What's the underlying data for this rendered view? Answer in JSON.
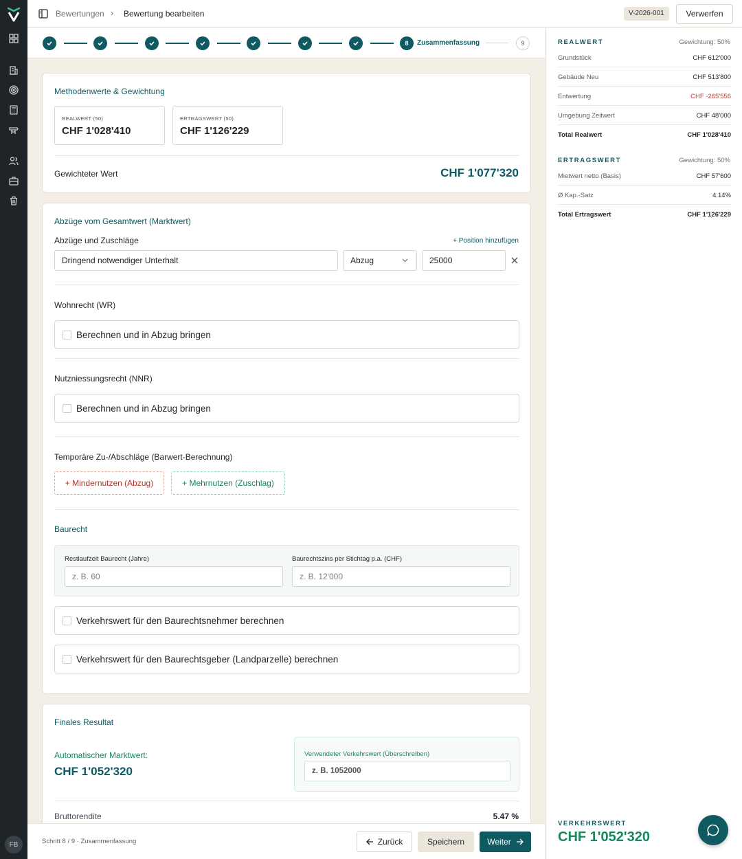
{
  "rail": {
    "avatar_initials": "FB",
    "icons": [
      "dashboard-icon",
      "building-icon",
      "target-icon",
      "calculator-icon",
      "signpost-icon",
      "users-icon",
      "briefcase-icon",
      "trash-icon"
    ]
  },
  "header": {
    "breadcrumb_parent": "Bewertungen",
    "breadcrumb_separator": "›",
    "breadcrumb_current": "Bewertung bearbeiten",
    "valuation_id": "V-2026-001",
    "discard_label": "Verwerfen"
  },
  "stepper": {
    "completed_steps": 7,
    "current_number": "8",
    "current_label": "Zusammenfassung",
    "next_number": "9"
  },
  "methods": {
    "title": "Methodenwerte & Gewichtung",
    "realwert_caption": "REALWERT (50)",
    "realwert_value": "CHF 1'028'410",
    "ertragswert_caption": "ERTRAGSWERT (50)",
    "ertragswert_value": "CHF 1'126'229",
    "weighted_label": "Gewichteter Wert",
    "weighted_value": "CHF 1'077'320"
  },
  "deductions": {
    "title": "Abzüge vom Gesamtwert (Marktwert)",
    "subtitle": "Abzüge und Zuschläge",
    "add_position": "+ Position hinzufügen",
    "item_description": "Dringend notwendiger Unterhalt",
    "item_type": "Abzug",
    "item_amount": "25000",
    "wohnrecht_label": "Wohnrecht (WR)",
    "wohnrecht_check": "Berechnen und in Abzug bringen",
    "nnr_label": "Nutzniessungsrecht (NNR)",
    "nnr_check": "Berechnen und in Abzug bringen",
    "temp_label": "Temporäre Zu-/Abschläge (Barwert-Berechnung)",
    "minder_button": "+ Mindernutzen (Abzug)",
    "mehr_button": "+ Mehrnutzen (Zuschlag)",
    "baurecht_title": "Baurecht",
    "restlaufzeit_label": "Restlaufzeit Baurecht (Jahre)",
    "restlaufzeit_placeholder": "z. B. 60",
    "zins_label": "Baurechtszins per Stichtag p.a. (CHF)",
    "zins_placeholder": "z. B. 12'000",
    "check_nehmer": "Verkehrswert für den Baurechtsnehmer berechnen",
    "check_geber": "Verkehrswert für den Baurechtsgeber (Landparzelle) berechnen"
  },
  "final": {
    "title": "Finales Resultat",
    "auto_label": "Automatischer Marktwert:",
    "auto_value": "CHF 1'052'320",
    "override_label": "Verwendeter Verkehrswert (Überschreiben)",
    "override_placeholder": "z. B. 1052000",
    "bruttorendite_label": "Bruttorendite",
    "bruttorendite_value": "5.47 %"
  },
  "footer": {
    "status": "Schritt 8 / 9 · Zusammenfassung",
    "back_label": "Zurück",
    "save_label": "Speichern",
    "next_label": "Weiter"
  },
  "sidebar": {
    "realwert": {
      "heading": "REALWERT",
      "weight": "Gewichtung: 50%",
      "rows": [
        {
          "label": "Grundstück",
          "value": "CHF 612'000"
        },
        {
          "label": "Gebäude Neu",
          "value": "CHF 513'800"
        },
        {
          "label": "Entwertung",
          "value": "CHF -265'556"
        },
        {
          "label": "Umgebung Zeitwert",
          "value": "CHF 48'000"
        }
      ],
      "total_label": "Total Realwert",
      "total_value": "CHF 1'028'410"
    },
    "ertragswert": {
      "heading": "ERTRAGSWERT",
      "weight": "Gewichtung: 50%",
      "rows": [
        {
          "label": "Mietwert netto (Basis)",
          "value": "CHF 57'600"
        },
        {
          "label": "Ø Kap.-Satz",
          "value": "4.14%"
        }
      ],
      "total_label": "Total Ertragswert",
      "total_value": "CHF 1'126'229"
    },
    "verkehrswert_caption": "VERKEHRSWERT",
    "verkehrswert_value": "CHF 1'052'320"
  },
  "colors": {
    "accent": "#0f5a61",
    "positive": "#158a5b",
    "negative": "#c0392b",
    "rail": "#1e2428",
    "canvas": "#f3efe6"
  }
}
